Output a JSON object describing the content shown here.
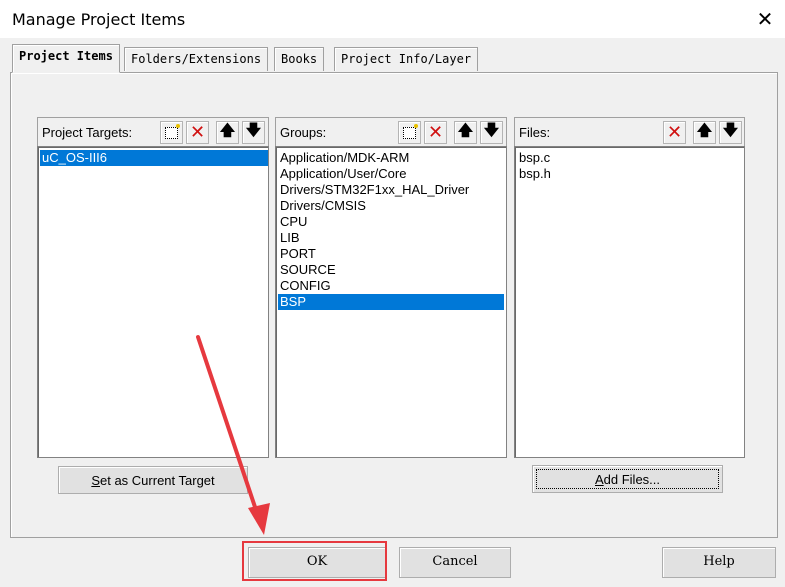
{
  "window": {
    "title": "Manage Project Items",
    "close_glyph": "✕"
  },
  "tabs": [
    {
      "label": "Project Items",
      "active": true
    },
    {
      "label": "Folders/Extensions",
      "active": false
    },
    {
      "label": "Books",
      "active": false
    },
    {
      "label": "Project Info/Layer",
      "active": false
    }
  ],
  "targets": {
    "label": "Project Targets:",
    "items": [
      "uC_OS-III6"
    ],
    "selected": "uC_OS-III6",
    "toolbar_icons": [
      "new-icon",
      "delete-icon",
      "move-up-icon",
      "move-down-icon"
    ]
  },
  "groups": {
    "label": "Groups:",
    "items": [
      "Application/MDK-ARM",
      "Application/User/Core",
      "Drivers/STM32F1xx_HAL_Driver",
      "Drivers/CMSIS",
      "CPU",
      "LIB",
      "PORT",
      "SOURCE",
      "CONFIG",
      "BSP"
    ],
    "selected": "BSP",
    "toolbar_icons": [
      "new-icon",
      "delete-icon",
      "move-up-icon",
      "move-down-icon"
    ]
  },
  "files": {
    "label": "Files:",
    "items": [
      "bsp.c",
      "bsp.h"
    ],
    "toolbar_icons": [
      "delete-icon",
      "move-up-icon",
      "move-down-icon"
    ]
  },
  "buttons": {
    "set_target_prefix": "S",
    "set_target_rest": "et as Current Target",
    "add_files_prefix": "A",
    "add_files_rest": "dd Files...",
    "ok": "OK",
    "cancel": "Cancel",
    "help": "Help"
  },
  "glyphs": {
    "delete": "✕",
    "up": "🡅",
    "down": "🡇"
  },
  "colors": {
    "selection": "#0078d7",
    "annotation": "#e6393f"
  }
}
